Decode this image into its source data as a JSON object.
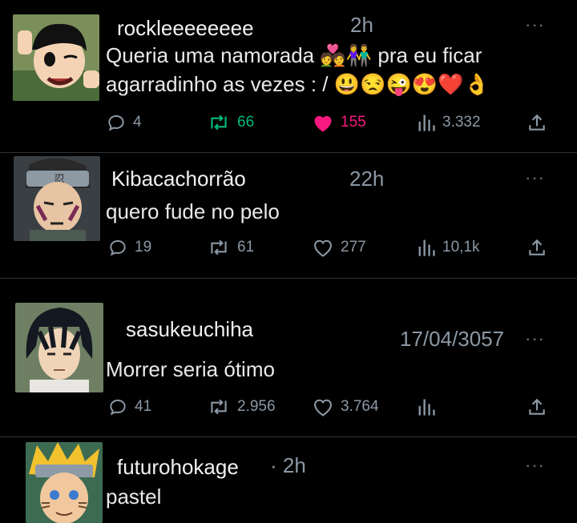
{
  "posts": [
    {
      "handle": "rockleeeeeeee",
      "time": "2h",
      "lines": [
        "Queria uma namorada",
        "pra eu ficar",
        "agarradinho as vezes : /"
      ],
      "emoji_inline": [
        "💑",
        "👫"
      ],
      "emoji_tail": [
        "😃",
        "😒",
        "😜",
        "😍",
        "❤️",
        "👌"
      ],
      "replies": "4",
      "reposts": "66",
      "likes": "155",
      "views": "3.332",
      "liked": true
    },
    {
      "handle": "Kibacachorrão",
      "time": "22h",
      "text": "quero fude no pelo",
      "replies": "19",
      "reposts": "61",
      "likes": "277",
      "views": "10,1k"
    },
    {
      "handle": "sasukeuchiha",
      "time": "17/04/3057",
      "text": "Morrer seria ótimo",
      "replies": "41",
      "reposts": "2.956",
      "likes": "3.764",
      "views": ""
    },
    {
      "handle": "futurohokage",
      "time": "· 2h",
      "text": "pastel"
    }
  ],
  "colors": {
    "background": "#000000",
    "repost_accent": "#00ba7c",
    "like_accent": "#f91880",
    "muted": "#8b98a5"
  },
  "icons": [
    "reply-icon",
    "repost-icon",
    "like-icon",
    "views-icon",
    "share-icon",
    "more-icon"
  ],
  "more_label": "···"
}
